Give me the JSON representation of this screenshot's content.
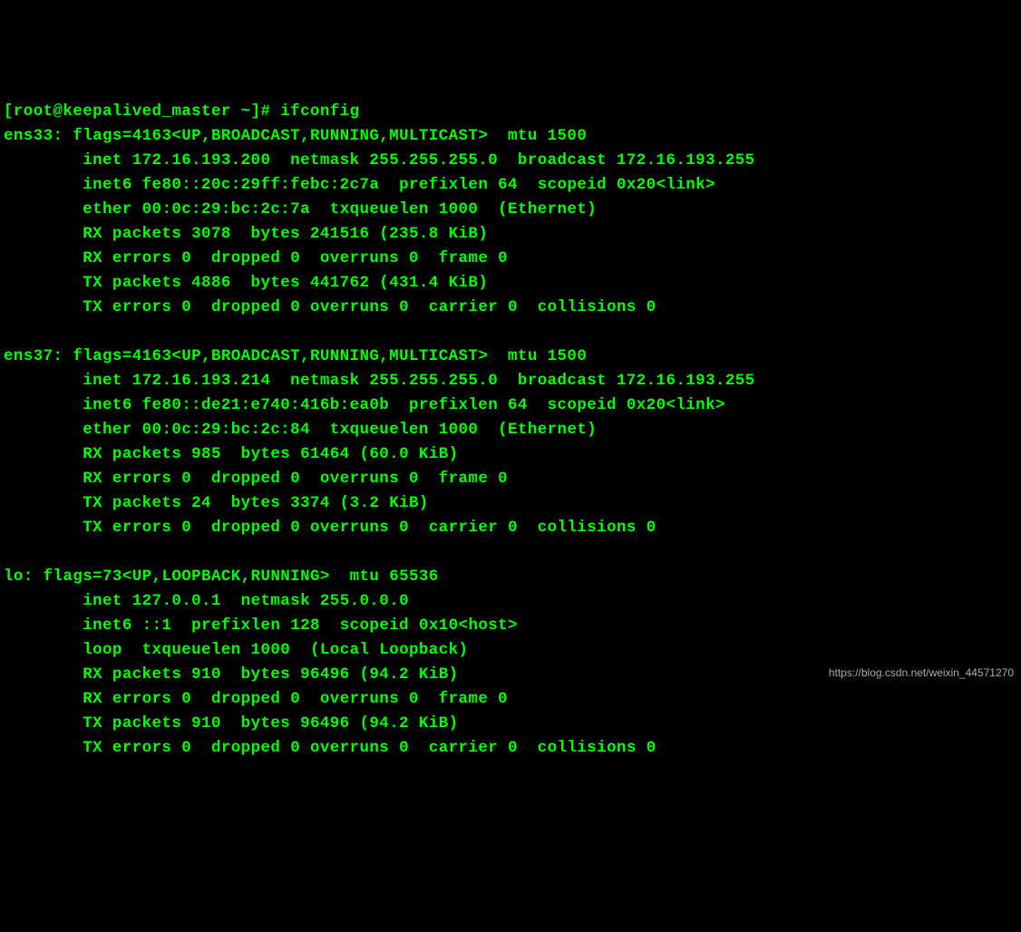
{
  "prompt": {
    "user": "root",
    "host": "keepalived_master",
    "cwd": "~",
    "symbol": "#",
    "command": "ifconfig"
  },
  "interfaces": [
    {
      "name": "ens33",
      "flags_num": "4163",
      "flags": "UP,BROADCAST,RUNNING,MULTICAST",
      "mtu": "1500",
      "inet": "172.16.193.200",
      "netmask": "255.255.255.0",
      "broadcast": "172.16.193.255",
      "inet6": "fe80::20c:29ff:febc:2c7a",
      "prefixlen": "64",
      "scopeid": "0x20<link>",
      "ether": "00:0c:29:bc:2c:7a",
      "txqueuelen": "1000",
      "iftype": "Ethernet",
      "rx_packets": "3078",
      "rx_bytes": "241516",
      "rx_bytes_h": "235.8 KiB",
      "rx_errors": "0",
      "rx_dropped": "0",
      "rx_overruns": "0",
      "rx_frame": "0",
      "tx_packets": "4886",
      "tx_bytes": "441762",
      "tx_bytes_h": "431.4 KiB",
      "tx_errors": "0",
      "tx_dropped": "0",
      "tx_overruns": "0",
      "tx_carrier": "0",
      "tx_collisions": "0"
    },
    {
      "name": "ens37",
      "flags_num": "4163",
      "flags": "UP,BROADCAST,RUNNING,MULTICAST",
      "mtu": "1500",
      "inet": "172.16.193.214",
      "netmask": "255.255.255.0",
      "broadcast": "172.16.193.255",
      "inet6": "fe80::de21:e740:416b:ea0b",
      "prefixlen": "64",
      "scopeid": "0x20<link>",
      "ether": "00:0c:29:bc:2c:84",
      "txqueuelen": "1000",
      "iftype": "Ethernet",
      "rx_packets": "985",
      "rx_bytes": "61464",
      "rx_bytes_h": "60.0 KiB",
      "rx_errors": "0",
      "rx_dropped": "0",
      "rx_overruns": "0",
      "rx_frame": "0",
      "tx_packets": "24",
      "tx_bytes": "3374",
      "tx_bytes_h": "3.2 KiB",
      "tx_errors": "0",
      "tx_dropped": "0",
      "tx_overruns": "0",
      "tx_carrier": "0",
      "tx_collisions": "0"
    },
    {
      "name": "lo",
      "flags_num": "73",
      "flags": "UP,LOOPBACK,RUNNING",
      "mtu": "65536",
      "inet": "127.0.0.1",
      "netmask": "255.0.0.0",
      "broadcast": null,
      "inet6": "::1",
      "prefixlen": "128",
      "scopeid": "0x10<host>",
      "loop": true,
      "txqueuelen": "1000",
      "iftype": "Local Loopback",
      "rx_packets": "910",
      "rx_bytes": "96496",
      "rx_bytes_h": "94.2 KiB",
      "rx_errors": "0",
      "rx_dropped": "0",
      "rx_overruns": "0",
      "rx_frame": "0",
      "tx_packets": "910",
      "tx_bytes": "96496",
      "tx_bytes_h": "94.2 KiB",
      "tx_errors": "0",
      "tx_dropped": "0",
      "tx_overruns": "0",
      "tx_carrier": "0",
      "tx_collisions": "0"
    }
  ],
  "watermark": "https://blog.csdn.net/weixin_44571270"
}
